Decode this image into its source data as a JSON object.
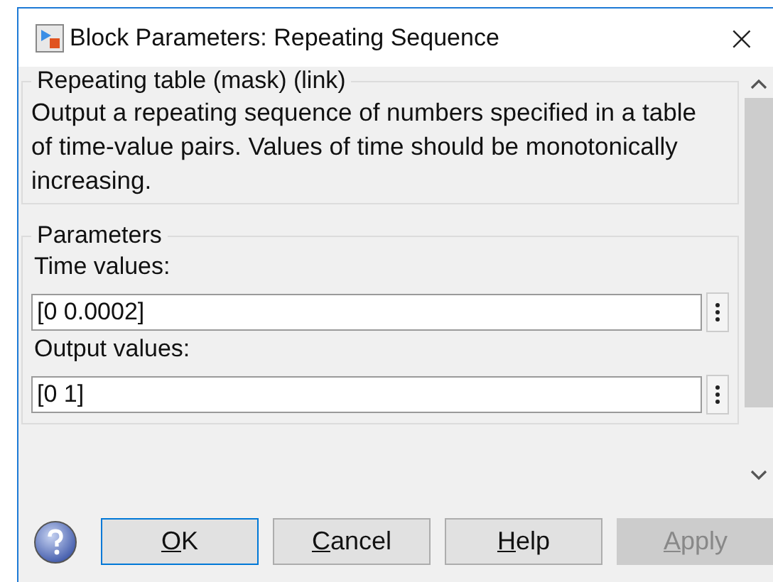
{
  "window": {
    "title": "Block Parameters: Repeating Sequence",
    "close": "×"
  },
  "description": {
    "title": "Repeating table (mask) (link)",
    "text": "Output a repeating sequence of numbers specified in a table of time-value pairs. Values of time should be monotonically increasing."
  },
  "parameters": {
    "title": "Parameters",
    "fields": [
      {
        "label": "Time values:",
        "value": "[0 0.0002]"
      },
      {
        "label": "Output values:",
        "value": "[0 1]"
      }
    ]
  },
  "buttons": [
    {
      "mnemonic": "O",
      "rest": "K",
      "default": true,
      "disabled": false
    },
    {
      "mnemonic": "C",
      "rest": "ancel",
      "default": false,
      "disabled": false
    },
    {
      "mnemonic": "H",
      "rest": "elp",
      "default": false,
      "disabled": false
    },
    {
      "mnemonic": "A",
      "rest": "pply",
      "default": false,
      "disabled": true
    }
  ]
}
